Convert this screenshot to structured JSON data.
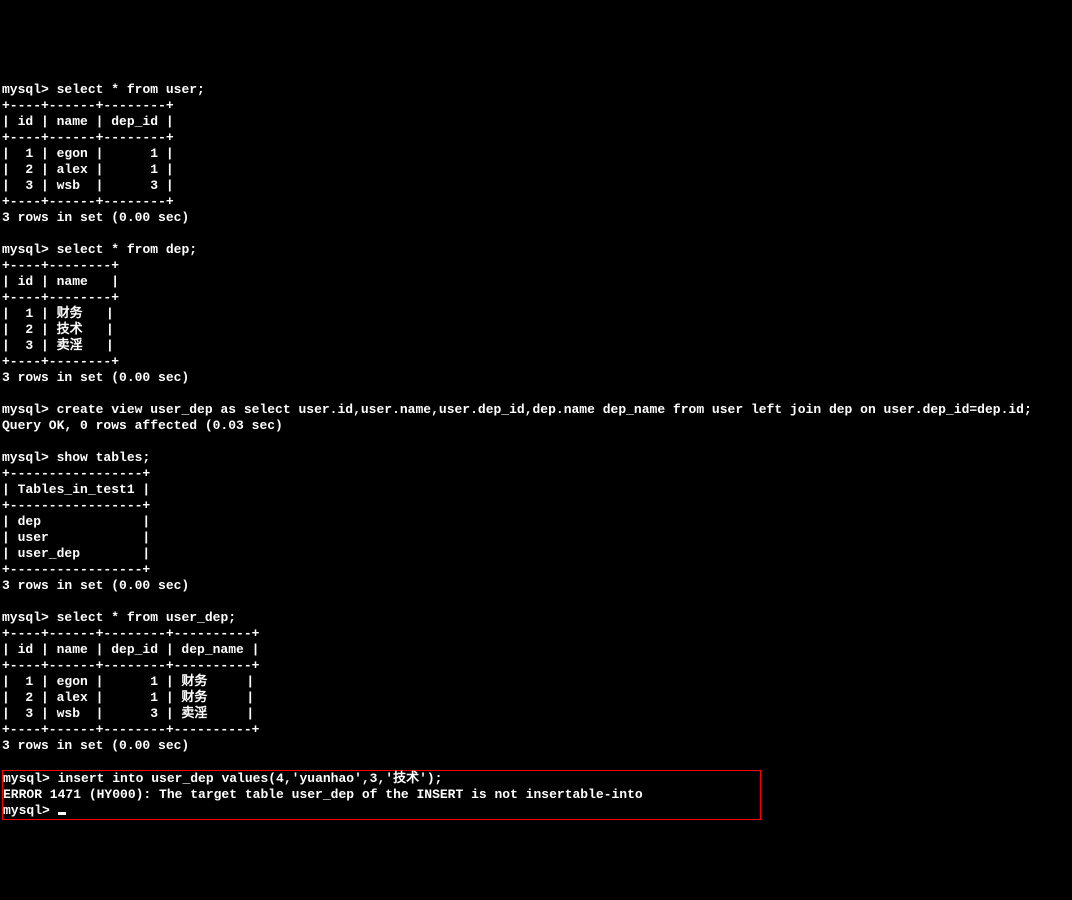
{
  "prompts": {
    "mysql": "mysql>"
  },
  "queries": {
    "q1": "select * from user;",
    "q2": "select * from dep;",
    "q3": "create view user_dep as select user.id,user.name,user.dep_id,dep.name dep_name from user left join dep on user.dep_id=dep.id;",
    "q4": "show tables;",
    "q5": "select * from user_dep;",
    "q6": "insert into user_dep values(4,'yuanhao',3,'技术');"
  },
  "table_user": {
    "border_top": "+----+------+--------+",
    "header": "| id | name | dep_id |",
    "rows": [
      "|  1 | egon |      1 |",
      "|  2 | alex |      1 |",
      "|  3 | wsb  |      3 |"
    ]
  },
  "table_dep": {
    "border_top": "+----+--------+",
    "header": "| id | name   |",
    "rows": [
      "|  1 | 财务   |",
      "|  2 | 技术   |",
      "|  3 | 卖淫   |"
    ]
  },
  "table_tables": {
    "border_top": "+-----------------+",
    "header": "| Tables_in_test1 |",
    "rows": [
      "| dep             |",
      "| user            |",
      "| user_dep        |"
    ]
  },
  "table_user_dep": {
    "border_top": "+----+------+--------+----------+",
    "header": "| id | name | dep_id | dep_name |",
    "rows": [
      "|  1 | egon |      1 | 财务     |",
      "|  2 | alex |      1 | 财务     |",
      "|  3 | wsb  |      3 | 卖淫     |"
    ]
  },
  "messages": {
    "rows3": "3 rows in set (0.00 sec)",
    "query_ok": "Query OK, 0 rows affected (0.03 sec)",
    "error": "ERROR 1471 (HY000): The target table user_dep of the INSERT is not insertable-into"
  }
}
